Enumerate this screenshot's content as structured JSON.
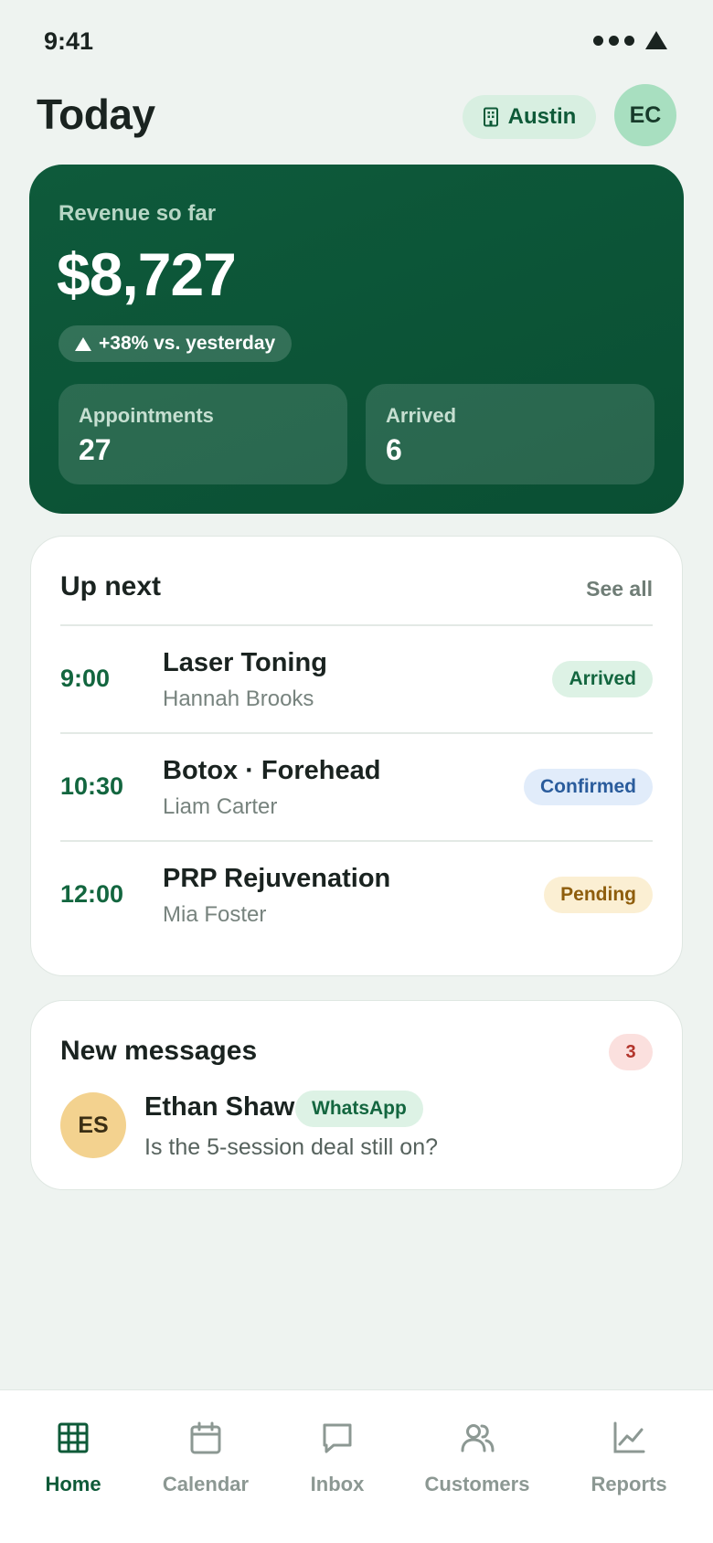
{
  "status_bar": {
    "time": "9:41"
  },
  "header": {
    "title": "Today",
    "location": "Austin",
    "user_initials": "EC"
  },
  "revenue": {
    "label": "Revenue so far",
    "value": "$8,727",
    "delta": "+38% vs. yesterday",
    "stats": [
      {
        "label": "Appointments",
        "value": "27"
      },
      {
        "label": "Arrived",
        "value": "6"
      }
    ]
  },
  "up_next": {
    "title": "Up next",
    "see_all": "See all",
    "appointments": [
      {
        "time": "9:00",
        "service": "Laser Toning",
        "client": "Hannah Brooks",
        "status": "Arrived"
      },
      {
        "time": "10:30",
        "service": "Botox · Forehead",
        "client": "Liam Carter",
        "status": "Confirmed"
      },
      {
        "time": "12:00",
        "service": "PRP Rejuvenation",
        "client": "Mia Foster",
        "status": "Pending"
      }
    ]
  },
  "messages": {
    "title": "New messages",
    "count": "3",
    "items": [
      {
        "initials": "ES",
        "name": "Ethan Shaw",
        "channel": "WhatsApp",
        "preview": "Is the 5-session deal still on?"
      }
    ]
  },
  "tabs": [
    {
      "label": "Home",
      "icon": "grid-icon",
      "active": true
    },
    {
      "label": "Calendar",
      "icon": "calendar-icon",
      "active": false
    },
    {
      "label": "Inbox",
      "icon": "chat-bubble-icon",
      "active": false
    },
    {
      "label": "Customers",
      "icon": "users-icon",
      "active": false
    },
    {
      "label": "Reports",
      "icon": "chart-icon",
      "active": false
    }
  ],
  "colors": {
    "brand": "#0e5a3b",
    "background": "#eef3f0",
    "status_arrived": "#13663f",
    "status_confirmed": "#2a5c9c",
    "status_pending": "#8e5d0c",
    "unread": "#b2342b"
  }
}
